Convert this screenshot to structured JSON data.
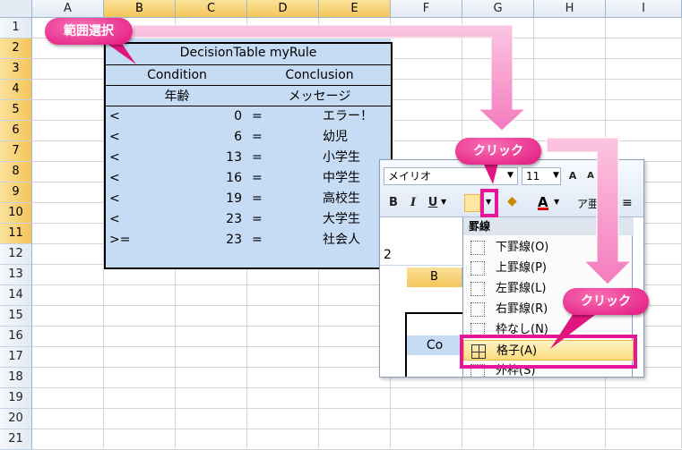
{
  "columns": [
    "A",
    "B",
    "C",
    "D",
    "E",
    "F",
    "G",
    "H",
    "I"
  ],
  "rows": [
    "1",
    "2",
    "3",
    "4",
    "5",
    "6",
    "7",
    "8",
    "9",
    "10",
    "11",
    "12",
    "13",
    "14",
    "15",
    "16",
    "17",
    "18",
    "19",
    "20",
    "21"
  ],
  "table": {
    "title": "DecisionTable myRule",
    "condition": "Condition",
    "conclusion": "Conclusion",
    "cond_col": "年齢",
    "concl_col": "メッセージ",
    "rules": [
      {
        "op": "<",
        "val": "0",
        "eq": "=",
        "msg": "エラー！"
      },
      {
        "op": "<",
        "val": "6",
        "eq": "=",
        "msg": "幼児"
      },
      {
        "op": "<",
        "val": "13",
        "eq": "=",
        "msg": "小学生"
      },
      {
        "op": "<",
        "val": "16",
        "eq": "=",
        "msg": "中学生"
      },
      {
        "op": "<",
        "val": "19",
        "eq": "=",
        "msg": "高校生"
      },
      {
        "op": "<",
        "val": "23",
        "eq": "=",
        "msg": "大学生"
      },
      {
        "op": ">=",
        "val": "23",
        "eq": "=",
        "msg": "社会人"
      }
    ]
  },
  "ribbon": {
    "font_name": "メイリオ",
    "font_size": "11",
    "bold": "B",
    "italic": "I",
    "underline": "U",
    "font_color": "A"
  },
  "border_menu": {
    "header": "罫線",
    "items": [
      "下罫線(O)",
      "上罫線(P)",
      "左罫線(L)",
      "右罫線(R)",
      "枠なし(N)",
      "格子(A)",
      "外枠(S)"
    ]
  },
  "mini": {
    "formula_value": "2",
    "col_label": "B",
    "cell_label": "Co"
  },
  "callouts": {
    "select": "範囲選択",
    "click1": "クリック",
    "click2": "クリック"
  },
  "colors": {
    "accent": "#e8179a",
    "selection": "#c6dcf5",
    "header_selected": "#f9d57a"
  }
}
